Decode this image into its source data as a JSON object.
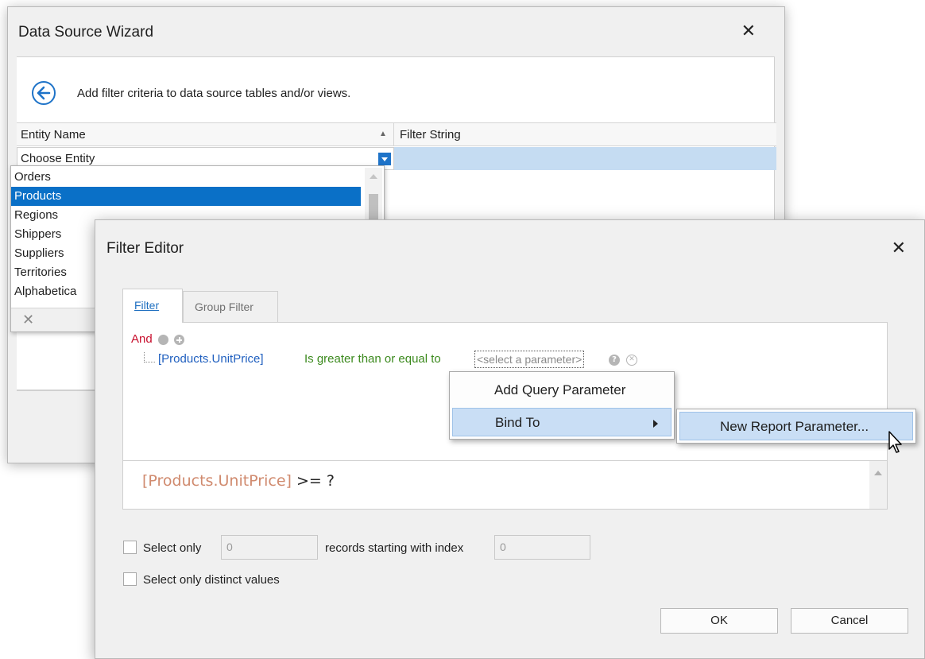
{
  "wizard": {
    "title": "Data Source Wizard",
    "instruction": "Add filter criteria to data source tables and/or views.",
    "columns": {
      "entity": "Entity Name",
      "filter": "Filter String"
    },
    "combo_value": "Choose Entity",
    "entity_list": [
      "Orders",
      "Products",
      "Regions",
      "Shippers",
      "Suppliers",
      "Territories",
      "Alphabetica"
    ],
    "selected_entity": "Products"
  },
  "filter_editor": {
    "title": "Filter Editor",
    "tabs": [
      "Filter",
      "Group Filter"
    ],
    "group_operator": "And",
    "condition": {
      "field": "[Products.UnitPrice]",
      "operator": "Is greater than or equal to",
      "value": "<select a parameter>"
    },
    "expression_field": "[Products.UnitPrice]",
    "expression_rest": " >= ?",
    "select_only_label": "Select only",
    "select_only_value": "0",
    "records_label": "records starting with index",
    "index_value": "0",
    "distinct_label": "Select only distinct values",
    "ok_label": "OK",
    "cancel_label": "Cancel"
  },
  "context_menu": {
    "items": [
      "Add Query Parameter",
      "Bind To"
    ],
    "submenu_items": [
      "New Report Parameter..."
    ]
  },
  "colors": {
    "accent": "#1e73c8",
    "selection": "#0a70c7",
    "operator_red": "#c8102e",
    "field_blue": "#1f5fbf",
    "operator_green": "#3c8a1e"
  }
}
